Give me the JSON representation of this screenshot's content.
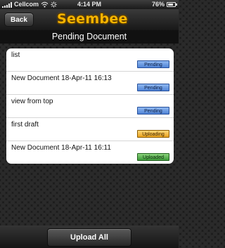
{
  "status_bar": {
    "carrier": "Cellcom",
    "time": "4:14 PM",
    "battery_percent": "76%",
    "battery_level": 0.76,
    "icons": [
      "signal-icon",
      "wifi-icon",
      "activity-spinner-icon",
      "battery-icon"
    ]
  },
  "nav": {
    "back_label": "Back",
    "logo_text": "Seembee"
  },
  "page_title": "Pending Document",
  "documents": [
    {
      "name": "list",
      "status": "Pending"
    },
    {
      "name": "New Document 18-Apr-11 16:13",
      "status": "Pending"
    },
    {
      "name": "view from top",
      "status": "Pending"
    },
    {
      "name": "first draft",
      "status": "Uploading"
    },
    {
      "name": "New Document 18-Apr-11 16:11",
      "status": "Uploaded"
    }
  ],
  "footer": {
    "upload_all_label": "Upload All"
  },
  "colors": {
    "logo": "#f7b500",
    "pending": "#4f83d6",
    "uploading": "#e8a21e",
    "uploaded": "#3e9a3a"
  }
}
